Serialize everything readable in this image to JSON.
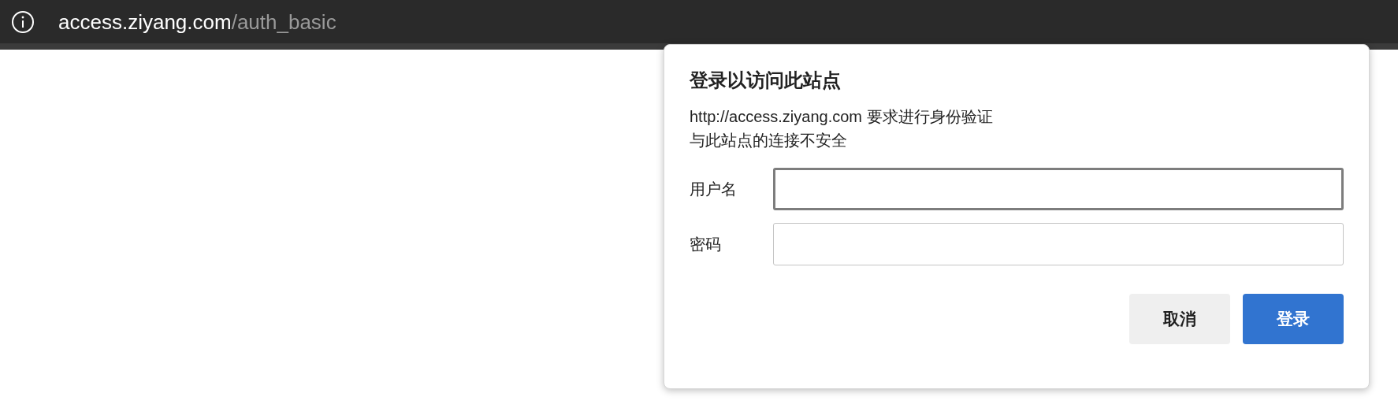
{
  "address_bar": {
    "host": "access.ziyang.com",
    "path": "/auth_basic"
  },
  "dialog": {
    "title": "登录以访问此站点",
    "message_lines": [
      "http://access.ziyang.com 要求进行身份验证",
      "与此站点的连接不安全"
    ],
    "fields": [
      {
        "label": "用户名",
        "focused": true
      },
      {
        "label": "密码",
        "focused": false
      }
    ],
    "buttons": [
      {
        "label": "取消",
        "kind": "secondary"
      },
      {
        "label": "登录",
        "kind": "primary"
      }
    ]
  }
}
